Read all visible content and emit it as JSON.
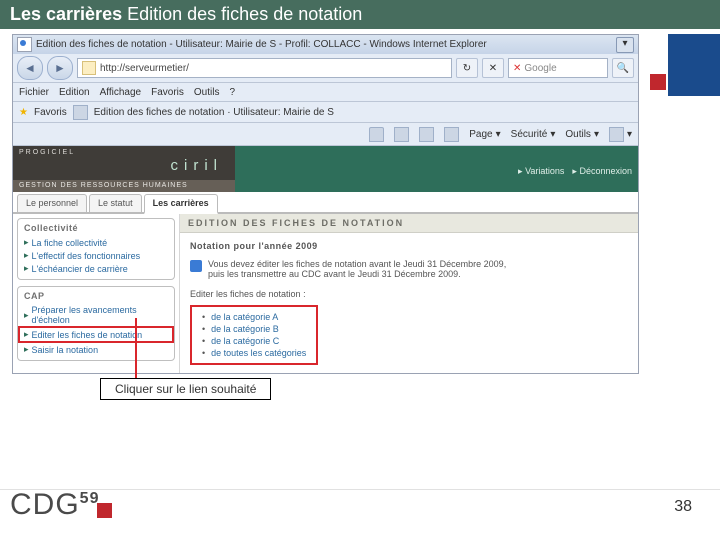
{
  "slide": {
    "title_left": "Les carrières",
    "title_right": "Edition des fiches de notation",
    "callout": "Cliquer sur le lien souhaité",
    "page_number": "38",
    "logo_text": "CDG",
    "logo_sup": "59"
  },
  "ie": {
    "window_title": "Edition des fiches de notation - Utilisateur: Mairie de S        - Profil: COLLACC - Windows Internet Explorer",
    "url": "http://serveurmetier/",
    "search_placeholder": "Google",
    "menu": [
      "Fichier",
      "Edition",
      "Affichage",
      "Favoris",
      "Outils",
      "?"
    ],
    "fav_label": "Favoris",
    "fav_page": "Edition des fiches de notation · Utilisateur: Mairie de S",
    "tools": {
      "page": "Page",
      "security": "Sécurité",
      "tools": "Outils",
      "help": "?"
    }
  },
  "app": {
    "brand_top": "PROGICIEL",
    "brand_ciril": "ciril",
    "brand_sub": "GESTION DES RESSOURCES HUMAINES",
    "topright": {
      "variations": "Variations",
      "logout": "Déconnexion"
    },
    "tabs": [
      "Le personnel",
      "Le statut",
      "Les carrières"
    ],
    "active_tab": 2,
    "sidebar": {
      "box1": {
        "title": "Collectivité",
        "items": [
          "La fiche collectivité",
          "L'effectif des fonctionnaires",
          "L'échéancier de carrière"
        ]
      },
      "box2": {
        "title": "CAP",
        "items": [
          "Préparer les avancements d'échelon",
          "Editer les fiches de notation",
          "Saisir la notation"
        ],
        "highlight_index": 1
      }
    },
    "main": {
      "header": "EDITION DES FICHES DE NOTATION",
      "subtitle": "Notation pour l'année 2009",
      "alert_line1": "Vous devez éditer les fiches de notation avant le Jeudi 31 Décembre 2009,",
      "alert_line2": "puis les transmettre au CDC avant le Jeudi 31 Décembre 2009.",
      "list_label": "Editer les fiches de notation :",
      "cats": [
        "de la catégorie A",
        "de la catégorie B",
        "de la catégorie C",
        "de toutes les catégories"
      ]
    }
  }
}
